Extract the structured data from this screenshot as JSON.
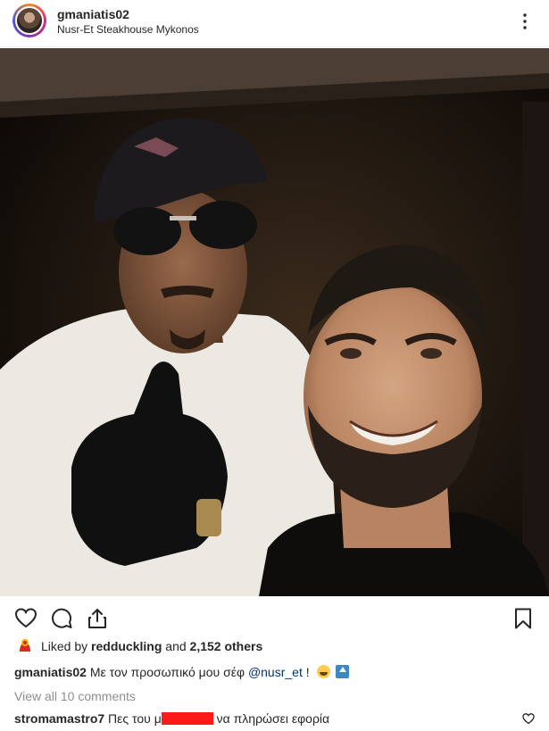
{
  "post": {
    "username": "gmaniatis02",
    "location": "Nusr-Et Steakhouse Mykonos"
  },
  "icons": {
    "more": "more-options-icon",
    "like": "heart-icon",
    "comment": "comment-icon",
    "share": "share-icon",
    "save": "bookmark-icon"
  },
  "likes": {
    "prefix": "Liked by",
    "user": "redduckling",
    "connector": "and",
    "others": "2,152 others"
  },
  "caption": {
    "username": "gmaniatis02",
    "text": "Με τον προσωπικό μου σέφ",
    "mention": "@nusr_et",
    "suffix": "!"
  },
  "view_all_comments": "View all 10 comments",
  "comment": {
    "username": "stromamastro7",
    "text_before": "Πες του μ",
    "text_after": "να πληρώσει εφορία"
  },
  "colors": {
    "text": "#262626",
    "muted": "#8e8e8e",
    "mention": "#003569",
    "redaction": "#ff1a1a"
  }
}
